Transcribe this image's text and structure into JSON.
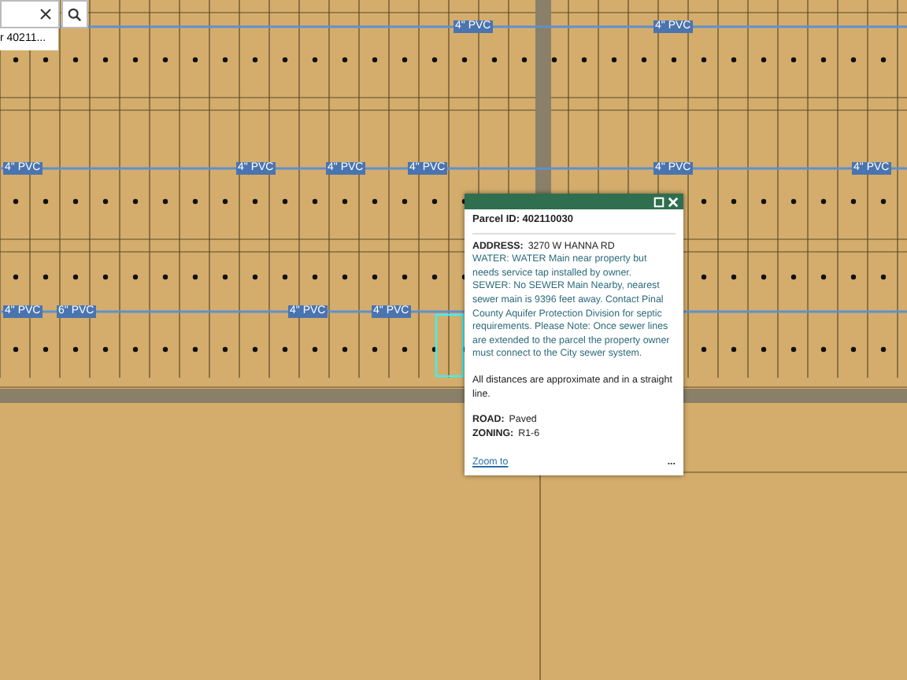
{
  "search": {
    "suggestion": "r 40211..."
  },
  "pipe_lines": [
    {
      "labels": [
        "4\" PVC",
        "4\" PVC"
      ]
    },
    {
      "labels": [
        "4\" PVC",
        "4\" PVC",
        "4\" PVC",
        "4\" PVC",
        "4\" PVC",
        "4\" PVC"
      ]
    },
    {
      "labels": [
        "4\" PVC",
        "6\" PVC",
        "4\" PVC",
        "4\" PVC"
      ]
    }
  ],
  "popup": {
    "title": "Parcel ID: 402110030",
    "address_label": "ADDRESS:",
    "address": "3270 W HANNA RD",
    "details": "WATER: WATER Main near property but needs service tap installed by owner.\nSEWER: No SEWER Main Nearby, nearest sewer main is 9396 feet away. Contact Pinal County Aquifer Protection Division for septic requirements. Please Note: Once sewer lines are extended to the parcel the property owner must connect to the City sewer system.",
    "note": "All distances are approximate and in a straight line.",
    "road_label": "ROAD:",
    "road": "Paved",
    "zoning_label": "ZONING:",
    "zoning": "R1-6",
    "zoom_link": "Zoom to",
    "more": "..."
  }
}
